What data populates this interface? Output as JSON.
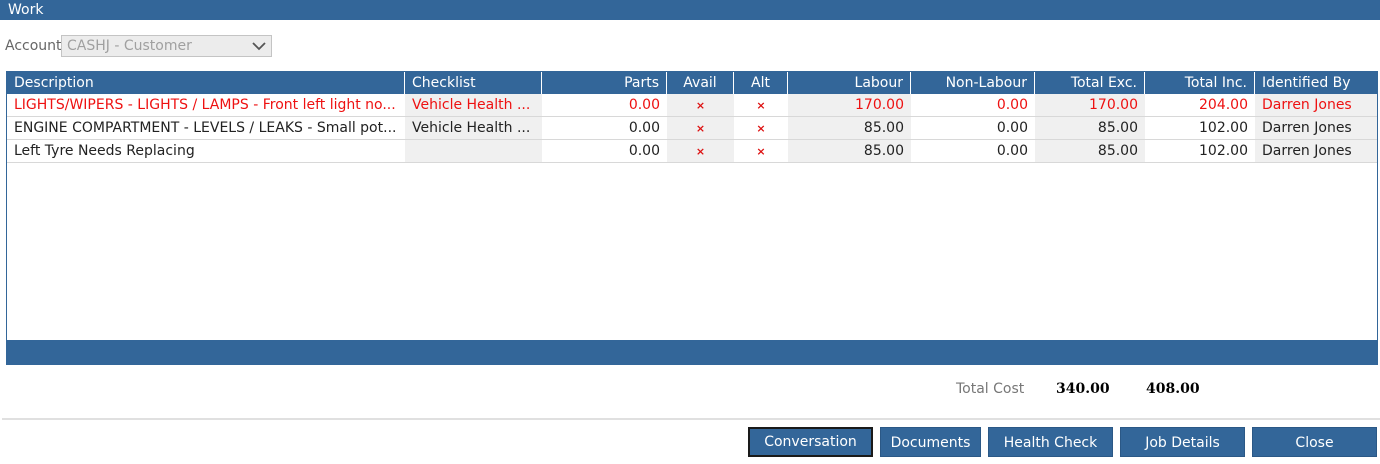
{
  "window": {
    "title": "Work"
  },
  "account": {
    "label": "Account",
    "value": "CASHJ - Customer"
  },
  "columns": {
    "description": "Description",
    "checklist": "Checklist",
    "parts": "Parts",
    "avail": "Avail",
    "alt": "Alt",
    "labour": "Labour",
    "non_labour": "Non-Labour",
    "total_exc": "Total Exc.",
    "total_inc": "Total Inc.",
    "identified_by": "Identified By"
  },
  "rows": [
    {
      "highlight": "red",
      "description": "LIGHTS/WIPERS - LIGHTS / LAMPS - Front left light no...",
      "checklist": "Vehicle Health ...",
      "parts": "0.00",
      "avail": "×",
      "alt": "×",
      "labour": "170.00",
      "non_labour": "0.00",
      "total_exc": "170.00",
      "total_inc": "204.00",
      "identified_by": "Darren Jones"
    },
    {
      "highlight": "none",
      "description": "ENGINE COMPARTMENT - LEVELS / LEAKS - Small pot...",
      "checklist": "Vehicle Health ...",
      "parts": "0.00",
      "avail": "×",
      "alt": "×",
      "labour": "85.00",
      "non_labour": "0.00",
      "total_exc": "85.00",
      "total_inc": "102.00",
      "identified_by": "Darren Jones"
    },
    {
      "highlight": "none",
      "description": "Left Tyre Needs Replacing",
      "checklist": "",
      "parts": "0.00",
      "avail": "×",
      "alt": "×",
      "labour": "85.00",
      "non_labour": "0.00",
      "total_exc": "85.00",
      "total_inc": "102.00",
      "identified_by": "Darren Jones"
    }
  ],
  "totals": {
    "label": "Total Cost",
    "exc": "340.00",
    "inc": "408.00"
  },
  "buttons": {
    "conversation": "Conversation",
    "documents": "Documents",
    "health_check": "Health Check",
    "job_details": "Job Details",
    "close": "Close"
  },
  "colors": {
    "header_bg": "#336699",
    "highlight_text": "#ee1111",
    "shade_bg": "#f0f0f0"
  },
  "icons": {
    "avail": "x-mark-icon",
    "alt": "x-mark-icon",
    "select": "chevron-down-icon"
  }
}
